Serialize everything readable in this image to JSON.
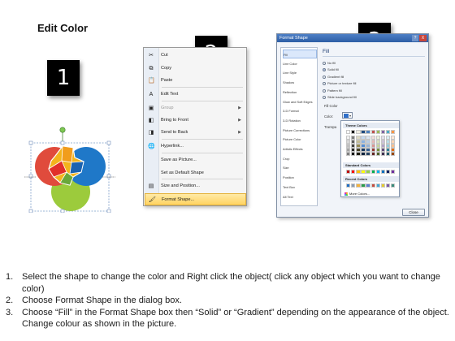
{
  "title": "Edit Color",
  "steps": {
    "one": "1",
    "two": "2",
    "three": "3"
  },
  "context_menu": {
    "items": [
      {
        "label": "Cut",
        "icon": "scissors-icon",
        "glyph": "✂",
        "disabled": false,
        "submenu": false
      },
      {
        "label": "Copy",
        "icon": "copy-icon",
        "glyph": "⧉",
        "disabled": false,
        "submenu": false
      },
      {
        "label": "Paste",
        "icon": "paste-icon",
        "glyph": "📋",
        "disabled": false,
        "submenu": false
      },
      {
        "label": "Edit Text",
        "icon": "edit-text-icon",
        "glyph": "A",
        "disabled": false,
        "submenu": false
      },
      {
        "label": "Group",
        "icon": "group-icon",
        "glyph": "▣",
        "disabled": true,
        "submenu": true
      },
      {
        "label": "Bring to Front",
        "icon": "bring-front-icon",
        "glyph": "◧",
        "disabled": false,
        "submenu": true
      },
      {
        "label": "Send to Back",
        "icon": "send-back-icon",
        "glyph": "◨",
        "disabled": false,
        "submenu": true
      },
      {
        "label": "Hyperlink...",
        "icon": "hyperlink-icon",
        "glyph": "🌐",
        "disabled": false,
        "submenu": false
      },
      {
        "label": "Save as Picture...",
        "icon": "",
        "glyph": "",
        "disabled": false,
        "submenu": false
      },
      {
        "label": "Set as Default Shape",
        "icon": "",
        "glyph": "",
        "disabled": false,
        "submenu": false
      },
      {
        "label": "Size and Position...",
        "icon": "size-position-icon",
        "glyph": "▤",
        "disabled": false,
        "submenu": false
      },
      {
        "label": "Format Shape...",
        "icon": "format-shape-icon",
        "glyph": "🖌",
        "disabled": false,
        "submenu": false
      }
    ]
  },
  "format_dialog": {
    "title": "Format Shape",
    "help": "?",
    "close": "X",
    "nav": [
      "Fill",
      "Line Color",
      "Line Style",
      "Shadow",
      "Reflection",
      "Glow and Soft Edges",
      "3-D Format",
      "3-D Rotation",
      "Picture Corrections",
      "Picture Color",
      "Artistic Effects",
      "Crop",
      "Size",
      "Position",
      "Text Box",
      "Alt Text"
    ],
    "panel_title": "Fill",
    "options": [
      "No fill",
      "Solid fill",
      "Gradient fill",
      "Picture or texture fill",
      "Pattern fill",
      "Slide background fill"
    ],
    "selected_option": 1,
    "fill_color_label": "Fill Color",
    "color_label": "Color:",
    "transparency_label": "Transpa",
    "close_button": "Close"
  },
  "palette": {
    "theme_label": "Theme Colors",
    "standard_label": "Standard Colors",
    "recent_label": "Recent Colors",
    "more_label": "More Colors...",
    "theme_top": [
      "#ffffff",
      "#000000",
      "#eeece1",
      "#1f497d",
      "#4f81bd",
      "#c0504d",
      "#9bbb59",
      "#8064a2",
      "#4bacc6",
      "#f79646"
    ],
    "theme_shades": [
      [
        "#f2f2f2",
        "#7f7f7f",
        "#ddd9c3",
        "#c6d9f0",
        "#dbe5f1",
        "#f2dcdb",
        "#ebf1dd",
        "#e5e0ec",
        "#dbeef3",
        "#fdeada"
      ],
      [
        "#d8d8d8",
        "#595959",
        "#c4bd97",
        "#8db3e2",
        "#b8cce4",
        "#e5b9b7",
        "#d7e3bc",
        "#ccc1d9",
        "#b7dde8",
        "#fbd5b5"
      ],
      [
        "#bfbfbf",
        "#3f3f3f",
        "#938953",
        "#548dd4",
        "#95b3d7",
        "#d99694",
        "#c3d69b",
        "#b2a2c7",
        "#92cddc",
        "#fac08f"
      ],
      [
        "#a5a5a5",
        "#262626",
        "#494429",
        "#17365d",
        "#366092",
        "#953734",
        "#76923c",
        "#5f497a",
        "#31859b",
        "#e36c09"
      ],
      [
        "#7f7f7f",
        "#0c0c0c",
        "#1d1b10",
        "#0f243e",
        "#244061",
        "#632423",
        "#4f6128",
        "#3f3151",
        "#205867",
        "#974806"
      ]
    ],
    "standard": [
      "#c00000",
      "#ff0000",
      "#ffc000",
      "#ffff00",
      "#92d050",
      "#00b050",
      "#00b0f0",
      "#0070c0",
      "#002060",
      "#7030a0"
    ],
    "recent": [
      "#1f6fc5",
      "#8a9db5",
      "#f4b23c",
      "#2a9d4a",
      "#5b7fd1",
      "#c84d3e",
      "#41a6d6",
      "#e4cb2f",
      "#7b58a8",
      "#3a8c7a"
    ]
  },
  "instructions": [
    {
      "num": "1.",
      "text": "Select the shape to change the color and Right click the object( click any object which you want to change color)"
    },
    {
      "num": "2.",
      "text": "Choose Format Shape in the dialog box."
    },
    {
      "num": "3.",
      "text": "Choose “Fill” in the Format Shape box then “Solid” or “Gradient” depending on the appearance of the object. Change colour as shown in the picture."
    }
  ]
}
